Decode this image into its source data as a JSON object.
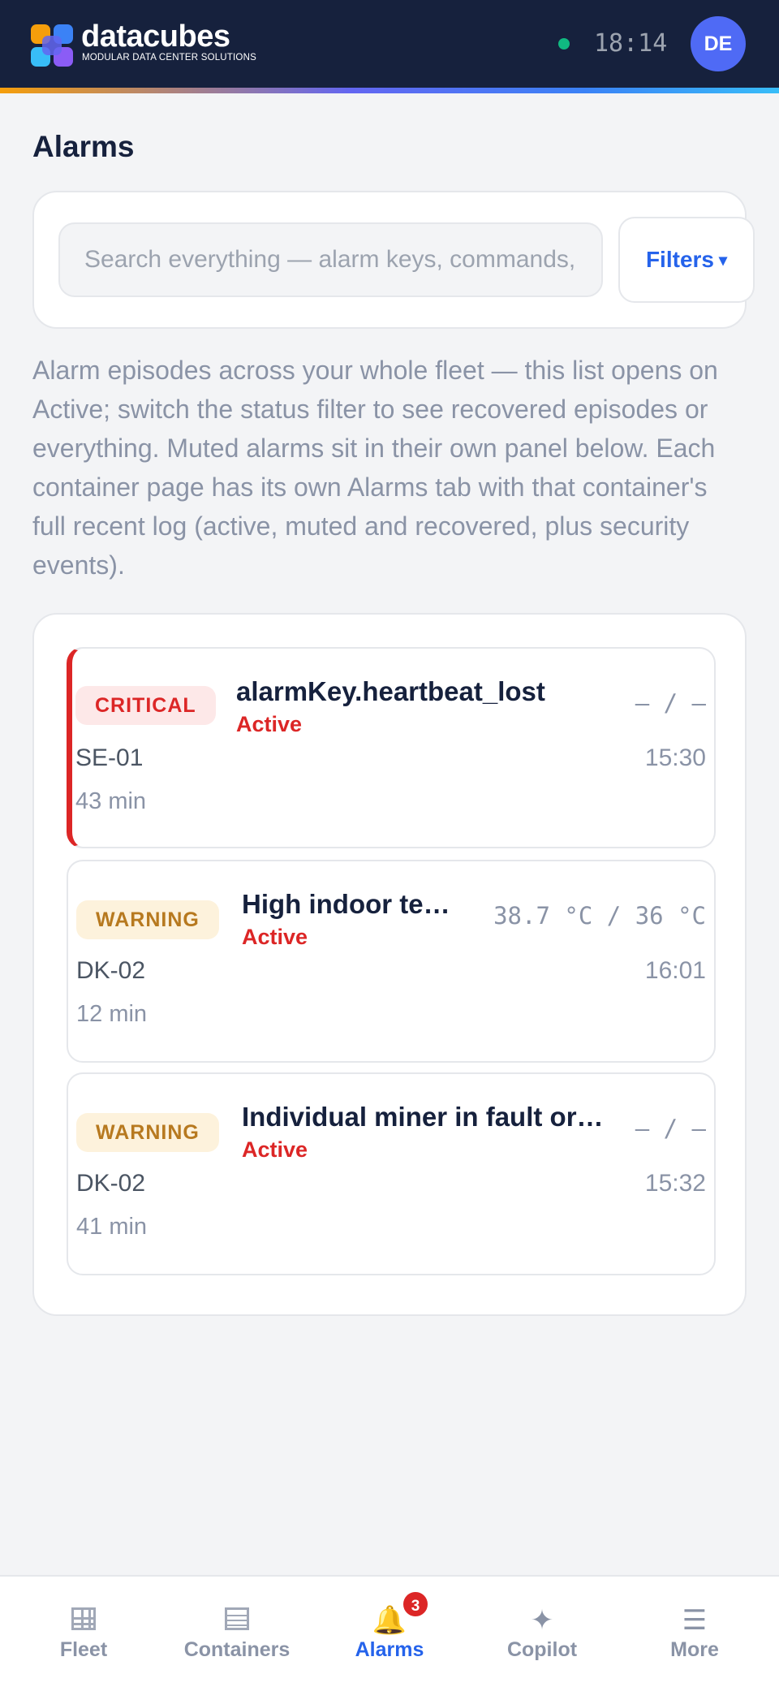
{
  "header": {
    "brand_name": "datacubes",
    "brand_tagline": "MODULAR DATA CENTER SOLUTIONS",
    "clock": "18:14",
    "avatar_initials": "DE",
    "connection_status_color": "#10b981"
  },
  "page": {
    "title": "Alarms"
  },
  "search": {
    "placeholder": "Search everything — alarm keys, commands, containers",
    "value": "",
    "filters_label": "Filters",
    "filters_caret": "▾"
  },
  "description": "Alarm episodes across your whole fleet — this list opens on Active; switch the status filter to see recovered episodes or everything. Muted alarms sit in their own panel below. Each container page has its own Alarms tab with that container's full recent log (active, muted and recovered, plus security events).",
  "alarms": [
    {
      "severity": "CRITICAL",
      "title": "alarmKey.heartbeat_lost",
      "status": "Active",
      "reading": "– / –",
      "container": "SE-01",
      "time": "15:30",
      "duration": "43 min"
    },
    {
      "severity": "WARNING",
      "title": "High indoor temperature",
      "status": "Active",
      "reading": "38.7 °C / 36 °C",
      "container": "DK-02",
      "time": "16:01",
      "duration": "12 min"
    },
    {
      "severity": "WARNING",
      "title": "Individual miner in fault or offline",
      "status": "Active",
      "reading": "– / –",
      "container": "DK-02",
      "time": "15:32",
      "duration": "41 min"
    }
  ],
  "nav": {
    "items": [
      {
        "label": "Fleet",
        "icon": "grid-icon"
      },
      {
        "label": "Containers",
        "icon": "list-icon"
      },
      {
        "label": "Alarms",
        "icon": "bell-icon",
        "badge": "3"
      },
      {
        "label": "Copilot",
        "icon": "sparkle-icon"
      },
      {
        "label": "More",
        "icon": "menu-icon"
      }
    ],
    "active": "Alarms"
  },
  "colors": {
    "header_bg": "#16213d",
    "accent": "#2563eb",
    "critical": "#dc2626",
    "warning": "#b7791f"
  }
}
